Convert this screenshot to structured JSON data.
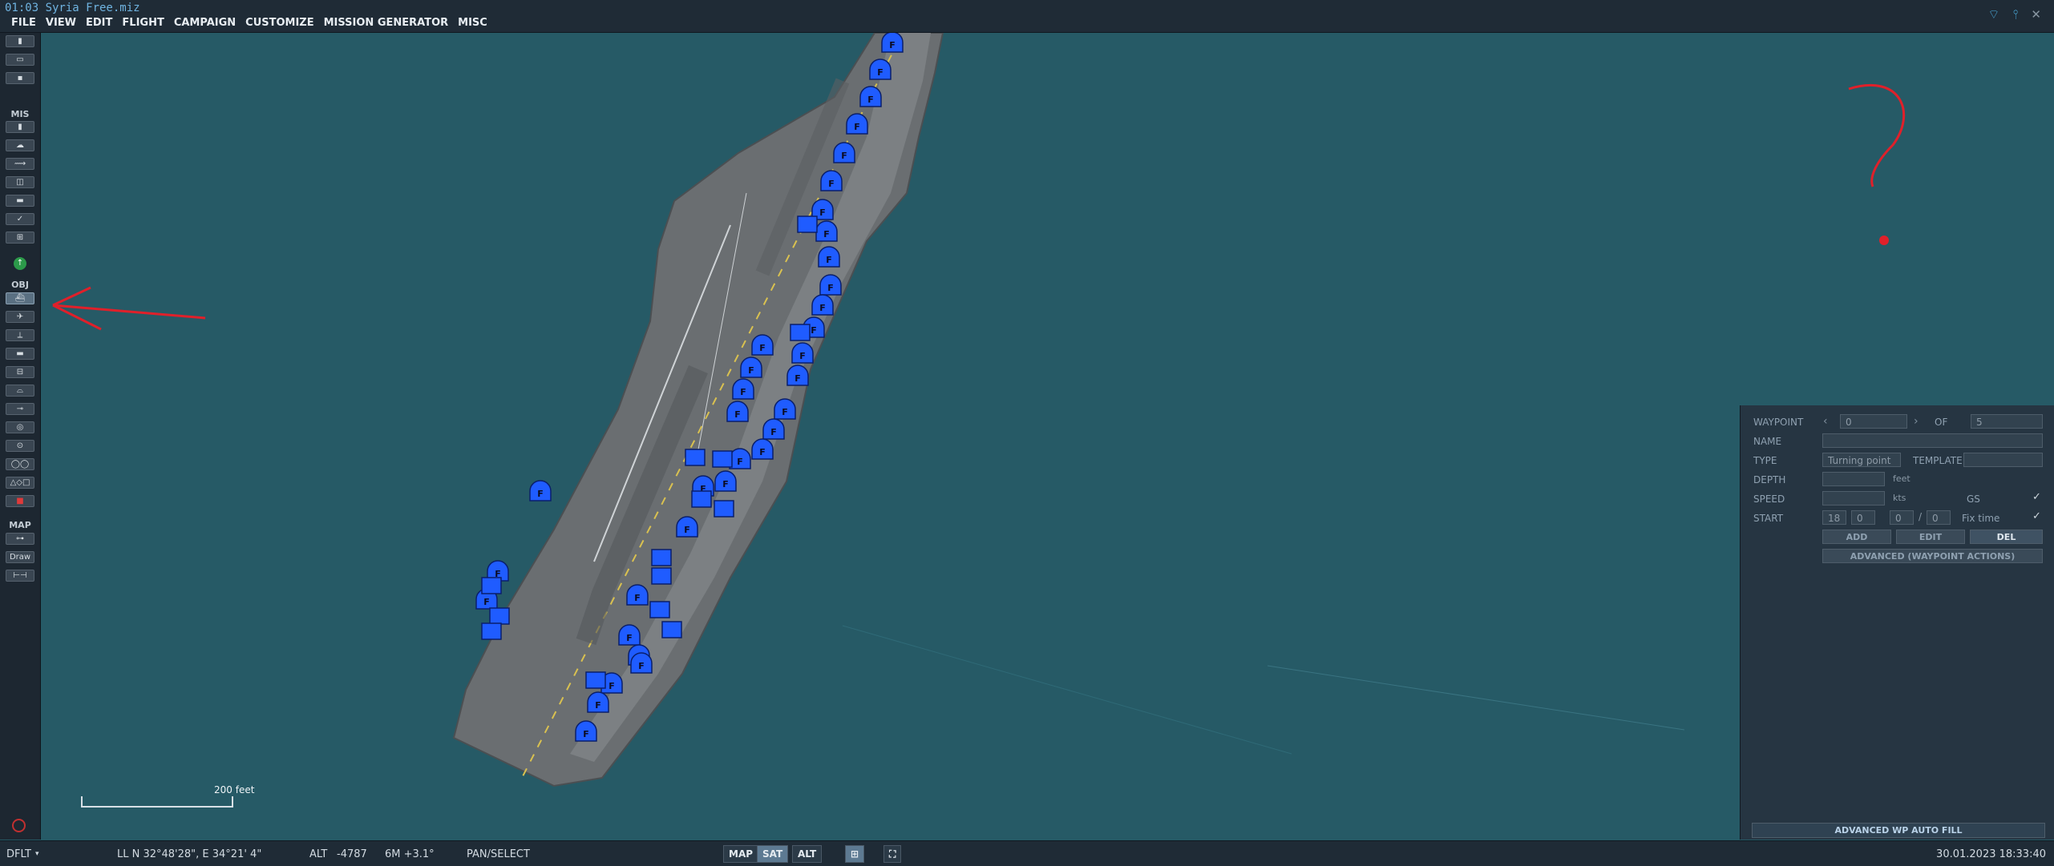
{
  "titlebar": {
    "title": "01:03 Syria  Free.miz"
  },
  "menubar": {
    "items": [
      "FILE",
      "VIEW",
      "EDIT",
      "FLIGHT",
      "CAMPAIGN",
      "CUSTOMIZE",
      "MISSION GENERATOR",
      "MISC"
    ]
  },
  "toolbar": {
    "sections": {
      "mis": "MIS",
      "obj": "OBJ",
      "map": "MAP"
    },
    "draw_label": "Draw"
  },
  "map": {
    "scale_label": "200 feet",
    "unit_marker": "F",
    "annotation_question": "?"
  },
  "waypoint_panel": {
    "waypoint_label": "WAYPOINT",
    "waypoint_value": "0",
    "of_label": "OF",
    "of_value": "5",
    "name_label": "NAME",
    "name_value": "",
    "type_label": "TYPE",
    "type_value": "Turning point",
    "template_label": "TEMPLATE",
    "template_value": "",
    "depth_label": "DEPTH",
    "depth_unit": "feet",
    "speed_label": "SPEED",
    "speed_unit": "kts",
    "gs_label": "GS",
    "start_label": "START",
    "start_h": "18",
    "start_m": "0",
    "start_s": "0",
    "start_d": "0",
    "start_sep": "/",
    "fix_time_label": "Fix time",
    "add_label": "ADD",
    "edit_label": "EDIT",
    "del_label": "DEL",
    "advanced_actions_label": "ADVANCED (WAYPOINT ACTIONS)",
    "autofill_label": "ADVANCED WP AUTO FILL"
  },
  "statusbar": {
    "profile": "DFLT",
    "coords": "LL  N 32°48'28\", E 34°21' 4\"",
    "alt_label": "ALT",
    "alt_value": "-4787",
    "mag": "6M  +3.1°",
    "mode": "PAN/SELECT",
    "btn_map": "MAP",
    "btn_sat": "SAT",
    "btn_alt": "ALT",
    "datetime": "30.01.2023 18:33:40"
  },
  "colors": {
    "sea": "#265a66",
    "unit_blue": "#1f5cff",
    "annotation_red": "#e0202a",
    "chrome": "#1f2b36"
  }
}
